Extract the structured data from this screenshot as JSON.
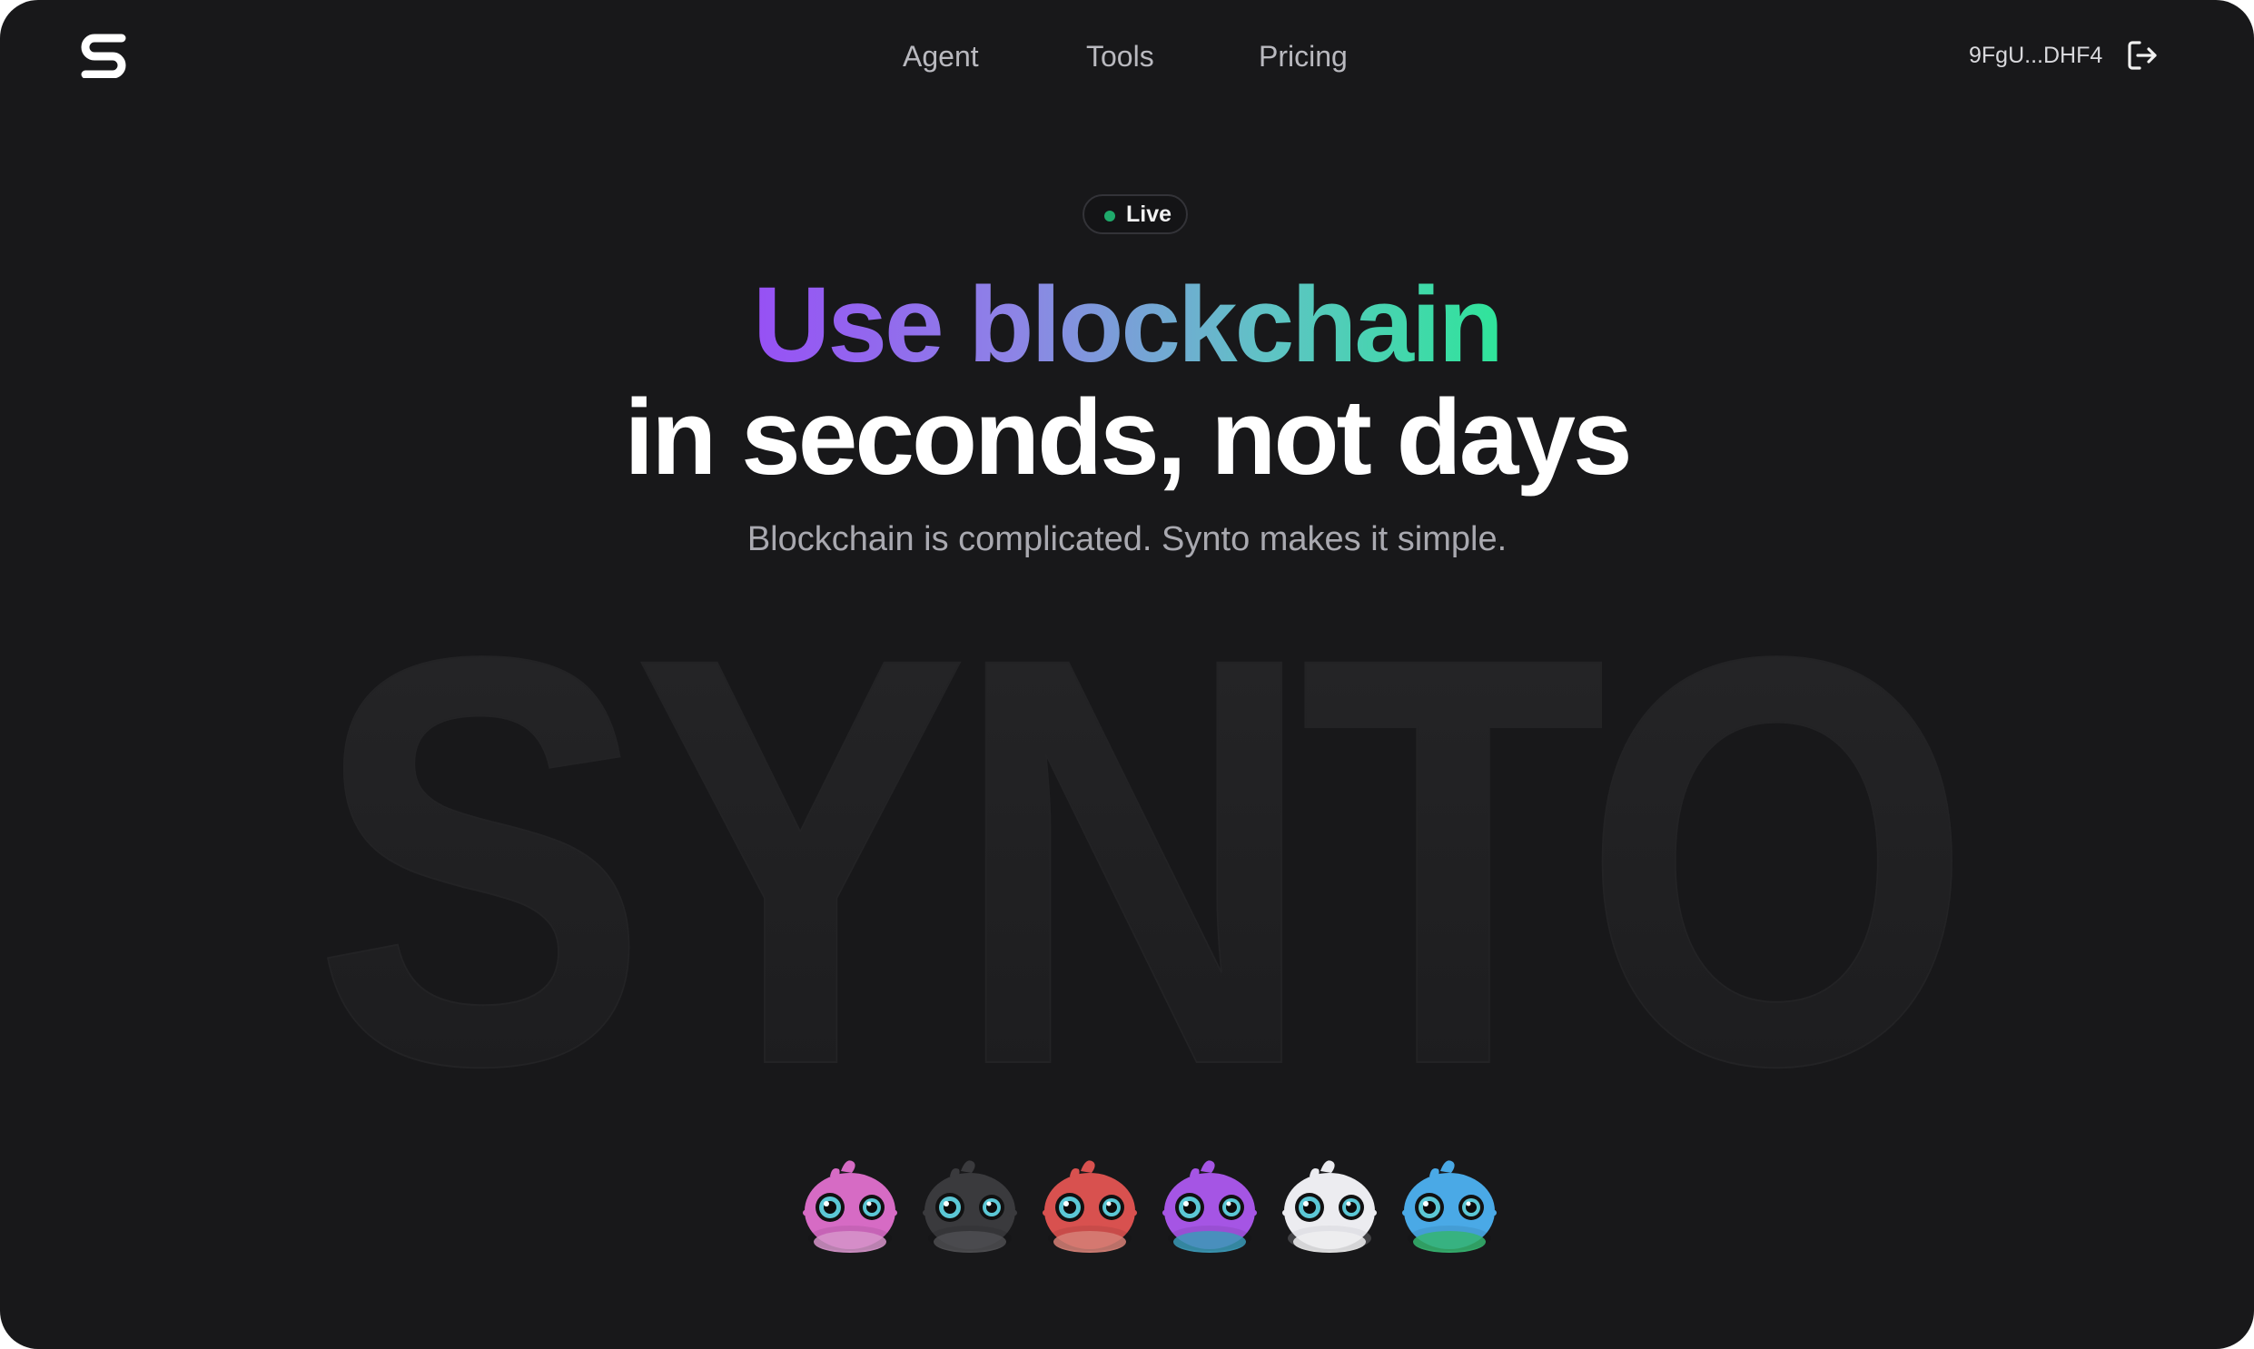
{
  "header": {
    "logo_icon": "synto-s-logo-icon",
    "nav": [
      "Agent",
      "Tools",
      "Pricing"
    ],
    "wallet_address": "9FgU...DHF4",
    "logout_icon": "logout-arrow-icon"
  },
  "hero": {
    "badge": "Live",
    "badge_color": "#1faa6b",
    "headline_line1": "Use blockchain",
    "headline_line2": "in seconds, not days",
    "subtitle": "Blockchain is complicated. Synto makes it simple.",
    "watermark": "SYNTO",
    "gradient_colors": [
      "#9750f5",
      "#60c2c6",
      "#2fe59a"
    ]
  },
  "mascots": [
    {
      "name": "pink-dino",
      "color": "#d66bc4",
      "belly": "#e9a0dc"
    },
    {
      "name": "black-dino",
      "color": "#3a3a3d",
      "belly": "#555558"
    },
    {
      "name": "red-dino",
      "color": "#d8514f",
      "belly": "#e98b80"
    },
    {
      "name": "purple-dino",
      "color": "#a555e4",
      "belly": "#3fa7c8"
    },
    {
      "name": "white-dino",
      "color": "#ececf0",
      "belly": "#ffffff"
    },
    {
      "name": "blue-dino",
      "color": "#4aa9e6",
      "belly": "#39c47a"
    }
  ]
}
